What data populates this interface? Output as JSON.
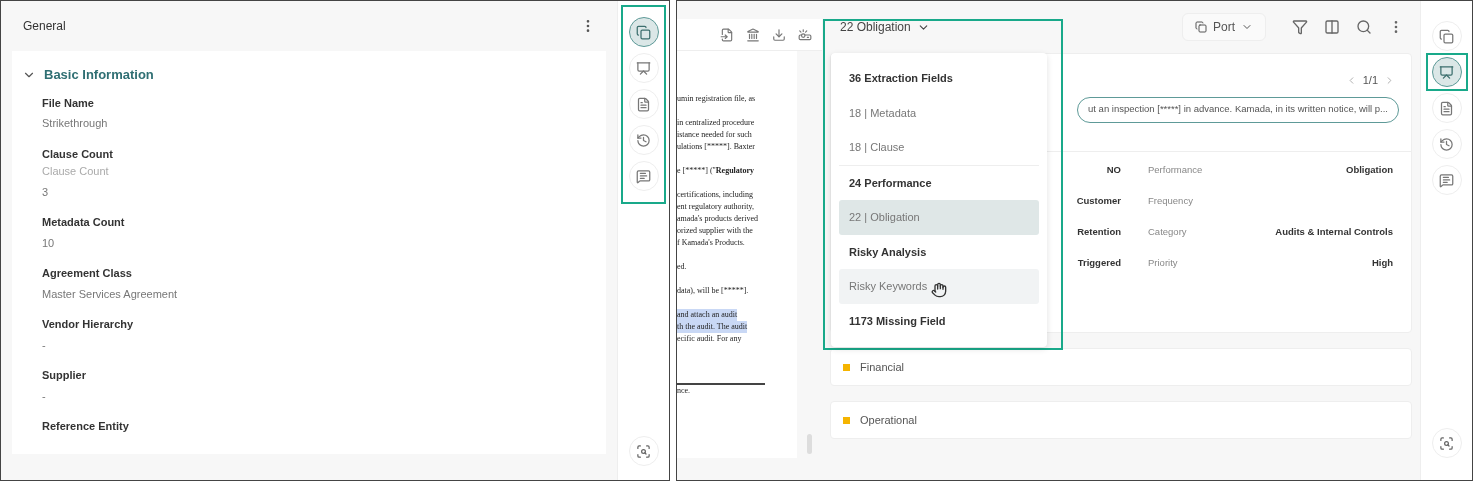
{
  "left_panel": {
    "header": {
      "title": "General"
    },
    "section": {
      "title": "Basic Information",
      "expanded": true,
      "fields": [
        {
          "label": "File Name",
          "values": [
            "Strikethrough"
          ]
        },
        {
          "label": "Clause Count",
          "values": [
            "Clause Count",
            "3"
          ]
        },
        {
          "label": "Metadata Count",
          "values": [
            "10"
          ]
        },
        {
          "label": "Agreement Class",
          "values": [
            "Master Services Agreement"
          ]
        },
        {
          "label": "Vendor Hierarchy",
          "values": [
            "-"
          ]
        },
        {
          "label": "Supplier",
          "values": [
            "-"
          ]
        },
        {
          "label": "Reference Entity"
        }
      ]
    },
    "rail": [
      {
        "kind": "copy",
        "selected": true
      },
      {
        "kind": "board",
        "selected": false
      },
      {
        "kind": "document",
        "selected": false
      },
      {
        "kind": "history",
        "selected": false
      },
      {
        "kind": "comment",
        "selected": false
      }
    ]
  },
  "right_panel": {
    "document": {
      "paragraphs": [
        {
          "lines": [
            {
              "text": "umin registration file, as",
              "highlighted": false
            }
          ]
        },
        {
          "lines": [
            {
              "text": "in centralized procedure",
              "highlighted": false
            },
            {
              "text": "istance needed for such",
              "highlighted": false
            },
            {
              "text": "ulations [*****]. Baxter",
              "highlighted": false
            }
          ]
        },
        {
          "lines": [
            {
              "text": "e [*****] (\"",
              "bold_tail": "Regulatory",
              "highlighted": false
            }
          ]
        },
        {
          "lines": [
            {
              "text": "certifications, including",
              "highlighted": false
            },
            {
              "text": "ent regulatory authority,",
              "highlighted": false
            },
            {
              "text": "amada's products derived",
              "highlighted": false
            },
            {
              "text": "orized supplier with the",
              "highlighted": false
            },
            {
              "text": "f Kamada's Products.",
              "highlighted": false
            }
          ]
        },
        {
          "lines": [
            {
              "text": "ed.",
              "highlighted": false
            }
          ]
        },
        {
          "lines": [
            {
              "text": "data), will be [*****].",
              "highlighted": false
            }
          ]
        },
        {
          "lines": [
            {
              "text": "and attach an audit",
              "highlighted": true
            },
            {
              "text": "th the audit. The audit",
              "highlighted": true
            },
            {
              "text": "ecific audit. For any",
              "highlighted": false
            }
          ]
        }
      ],
      "footer_text": "nce."
    },
    "dropdown": {
      "value": "22 Obligation",
      "expanded": true,
      "options": [
        {
          "kind": "group",
          "label": "36 Extraction Fields",
          "selected": false,
          "hovered": false
        },
        {
          "kind": "option",
          "label": "18 | Metadata",
          "selected": false,
          "hovered": false
        },
        {
          "kind": "option",
          "label": "18 | Clause",
          "selected": false,
          "hovered": false
        },
        {
          "kind": "group",
          "label": "24 Performance",
          "selected": false,
          "hovered": false
        },
        {
          "kind": "option",
          "label": "22 | Obligation",
          "selected": true,
          "hovered": false
        },
        {
          "kind": "group",
          "label": "Risky Analysis",
          "selected": false,
          "hovered": false
        },
        {
          "kind": "option",
          "label": "Risky Keywords",
          "selected": false,
          "hovered": true
        },
        {
          "kind": "group",
          "label": "1173 Missing Field",
          "selected": false,
          "hovered": false
        }
      ]
    },
    "port_button": "Port",
    "pager": "1/1",
    "snippet": "ut an inspection [*****] in advance. Kamada, in its written notice, will p...",
    "rows": [
      {
        "left": "NO",
        "label": "Performance",
        "value": "Obligation"
      },
      {
        "left": "Customer",
        "label": "Frequency"
      },
      {
        "left": "Retention",
        "label": "Category",
        "value": "Audits & Internal Controls"
      },
      {
        "left": "Triggered",
        "label": "Priority",
        "value": "High"
      }
    ],
    "groups": [
      {
        "label": "Financial",
        "color": "#f5b400"
      },
      {
        "label": "Operational",
        "color": "#f5b400"
      }
    ],
    "rail": [
      {
        "kind": "copy",
        "selected": false
      },
      {
        "kind": "board",
        "selected": true
      },
      {
        "kind": "document",
        "selected": false
      },
      {
        "kind": "history",
        "selected": false
      },
      {
        "kind": "comment",
        "selected": false
      }
    ]
  }
}
